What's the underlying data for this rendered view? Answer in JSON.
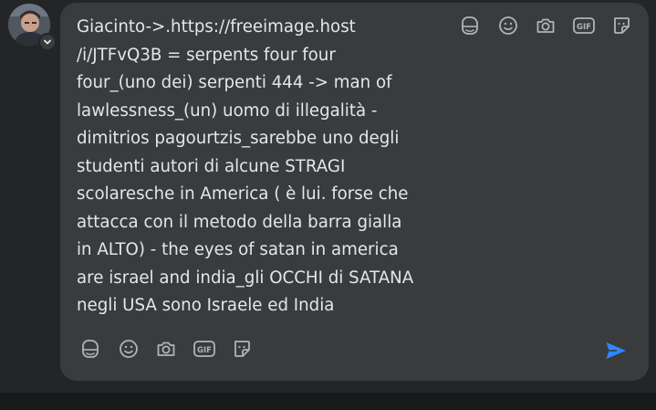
{
  "comment": {
    "text": "Giacinto->.https://freeimage.host\n/i/JTFvQ3B = serpents four four\nfour_(uno dei) serpenti 444 -> man of\nlawlessness_(un) uomo di illegalità -\ndimitrios pagourtzis_sarebbe uno degli\nstudenti autori di alcune STRAGI\nscolaresche in America ( è lui. forse che\nattacca con il metodo della barra gialla\nin ALTO) - the eyes of satan in america\nare israel and india_gli OCCHI di SATANA\nnegli USA sono Israele ed India"
  },
  "icons": {
    "gif_label": "GIF",
    "top_row": [
      "avatar-sticker-icon",
      "emoji-icon",
      "camera-icon",
      "gif-icon",
      "sticker-icon"
    ],
    "bottom_row": [
      "avatar-sticker-icon",
      "emoji-icon",
      "camera-icon",
      "gif-icon",
      "sticker-icon"
    ],
    "send": "send-icon"
  },
  "colors": {
    "page_background": "#242526",
    "composer_background": "#3a3b3c",
    "text": "#e4e6eb",
    "icon": "#b0b3b8",
    "send": "#2d88ff"
  }
}
